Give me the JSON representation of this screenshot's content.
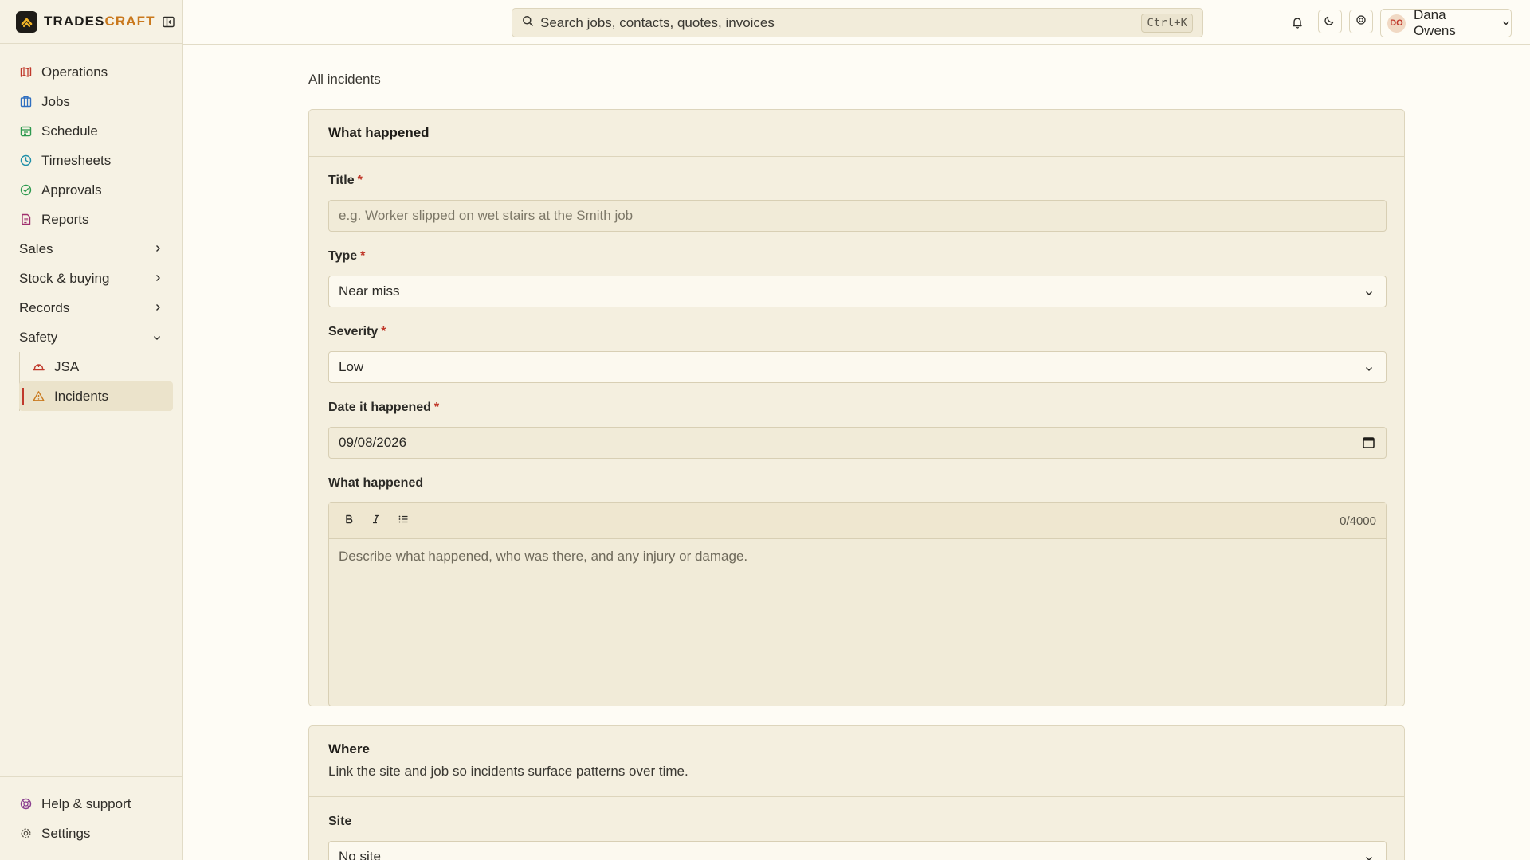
{
  "brand": {
    "name_main": "TRADES",
    "name_accent": "CRAFT"
  },
  "nav": {
    "items": [
      {
        "label": "Operations",
        "icon": "map-icon",
        "color": "#c0392b"
      },
      {
        "label": "Jobs",
        "icon": "building-icon",
        "color": "#2f6fc0"
      },
      {
        "label": "Schedule",
        "icon": "calendar-icon",
        "color": "#2e9a4f"
      },
      {
        "label": "Timesheets",
        "icon": "clock-icon",
        "color": "#1f8fa8"
      },
      {
        "label": "Approvals",
        "icon": "check-circle-icon",
        "color": "#2e9a4f"
      },
      {
        "label": "Reports",
        "icon": "report-icon",
        "color": "#a0306e"
      }
    ],
    "groups": [
      {
        "label": "Sales"
      },
      {
        "label": "Stock & buying"
      },
      {
        "label": "Records"
      },
      {
        "label": "Safety"
      }
    ],
    "safety_items": [
      {
        "label": "JSA",
        "icon": "hardhat-icon"
      },
      {
        "label": "Incidents",
        "icon": "warning-icon"
      }
    ],
    "bottom": [
      {
        "label": "Help & support",
        "icon": "lifebuoy-icon",
        "color": "#8a3e8f"
      },
      {
        "label": "Settings",
        "icon": "gear-icon",
        "color": "#5b574c"
      }
    ]
  },
  "topbar": {
    "search_placeholder": "Search jobs, contacts, quotes, invoices",
    "shortcut": "Ctrl+K",
    "user_initials": "DO",
    "user_name": "Dana Owens"
  },
  "page": {
    "breadcrumb": "All incidents"
  },
  "what_happened": {
    "title": "What happened",
    "title_label": "Title",
    "title_placeholder": "e.g. Worker slipped on wet stairs at the Smith job",
    "type_label": "Type",
    "type_value": "Near miss",
    "severity_label": "Severity",
    "severity_value": "Low",
    "date_label": "Date it happened",
    "date_value": "09/08/2026",
    "desc_label": "What happened",
    "desc_counter": "0/4000",
    "desc_placeholder": "Describe what happened, who was there, and any injury or damage.",
    "required_mark": "*"
  },
  "where": {
    "title": "Where",
    "description": "Link the site and job so incidents surface patterns over time.",
    "site_label": "Site",
    "site_value": "No site"
  },
  "colors": {
    "accent": "#c9781c",
    "required": "#c0392b",
    "active_bg": "#ebe3cb"
  }
}
